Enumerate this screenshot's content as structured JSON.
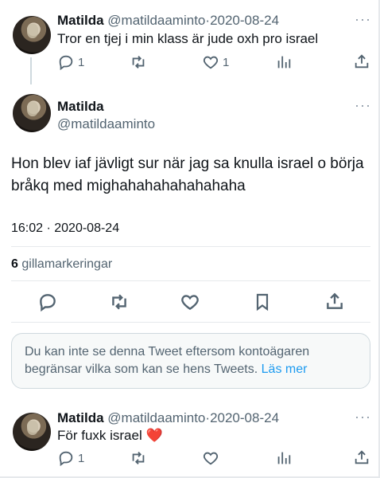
{
  "tweet1": {
    "name": "Matilda",
    "handle": "@matildaaminto",
    "dot": "·",
    "date": "2020-08-24",
    "text": "Tror en tjej i min klass är jude oxh pro israel",
    "reply_count": "1",
    "like_count": "1"
  },
  "main": {
    "name": "Matilda",
    "handle": "@matildaaminto",
    "text_line1": "Hon blev iaf jävligt sur när jag sa knulla israel o börja",
    "text_line2": "bråkq med mighahahahahahahaha",
    "timestamp": "16:02 · 2020-08-24",
    "likes_count": "6",
    "likes_label": "gillamarkeringar"
  },
  "notice": {
    "text": "Du kan inte se denna Tweet eftersom kontoägaren begränsar vilka som kan se hens Tweets.",
    "link": "Läs mer"
  },
  "tweet3": {
    "name": "Matilda",
    "handle": "@matildaaminto",
    "dot": "·",
    "date": "2020-08-24",
    "text": "För fuxk israel",
    "emoji": "❤️",
    "reply_count": "1"
  },
  "colors": {
    "link": "#1d9bf0",
    "muted": "#536471",
    "border": "#cfd9de"
  }
}
